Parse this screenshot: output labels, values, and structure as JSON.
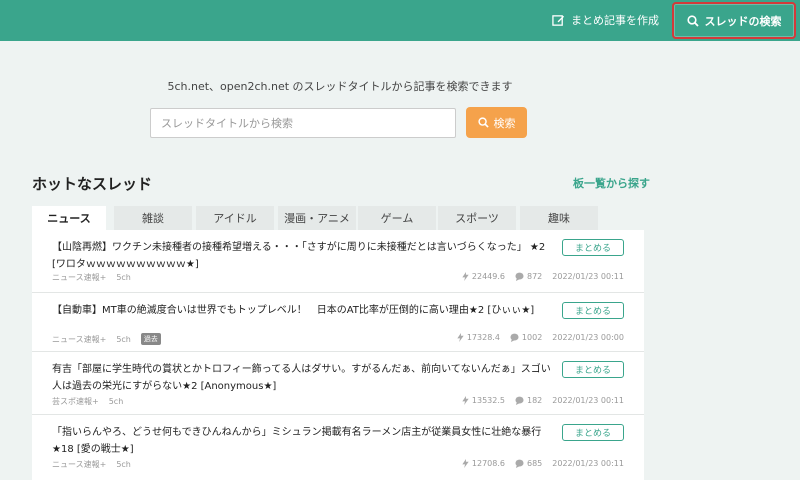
{
  "header": {
    "create_label": "まとめ記事を作成",
    "search_label": "スレッドの検索"
  },
  "search": {
    "description": "5ch.net、open2ch.net のスレッドタイトルから記事を検索できます",
    "placeholder": "スレッドタイトルから検索",
    "button_label": "検索"
  },
  "hot": {
    "title": "ホットなスレッド",
    "browse_link": "板一覧から探す"
  },
  "tabs": [
    {
      "label": "ニュース",
      "active": true
    },
    {
      "label": "雑談"
    },
    {
      "label": "アイドル"
    },
    {
      "label": "漫画・アニメ"
    },
    {
      "label": "ゲーム"
    },
    {
      "label": "スポーツ"
    },
    {
      "label": "趣味"
    }
  ],
  "threads": [
    {
      "title": "【山陰再燃】ワクチン未接種者の接種希望増える・・・「さすがに周りに未接種だとは言いづらくなった」 ★2 [ワロタｗｗｗｗｗｗｗｗｗｗ★]",
      "button": "まとめる",
      "board": "ニュース速報+",
      "site": "5ch",
      "badge": "",
      "speed": "22449.6",
      "comments": "872",
      "date": "2022/01/23 00:11"
    },
    {
      "title": "【自動車】MT車の絶滅度合いは世界でもトップレベル！　日本のAT比率が圧倒的に高い理由★2 [ひぃぃ★]",
      "button": "まとめる",
      "board": "ニュース速報+",
      "site": "5ch",
      "badge": "過去",
      "speed": "17328.4",
      "comments": "1002",
      "date": "2022/01/23 00:00"
    },
    {
      "title": "有吉「部屋に学生時代の賞状とかトロフィー飾ってる人はダサい。すがるんだぁ、前向いてないんだぁ」スゴい人は過去の栄光にすがらない★2 [Anonymous★]",
      "button": "まとめる",
      "board": "芸スポ速報+",
      "site": "5ch",
      "badge": "",
      "speed": "13532.5",
      "comments": "182",
      "date": "2022/01/23 00:11"
    },
    {
      "title": "「指いらんやろ、どうせ何もできひんねんから」ミシュラン掲載有名ラーメン店主が従業員女性に壮絶な暴行★18 [愛の戦士★]",
      "button": "まとめる",
      "board": "ニュース速報+",
      "site": "5ch",
      "badge": "",
      "speed": "12708.6",
      "comments": "685",
      "date": "2022/01/23 00:11"
    }
  ]
}
